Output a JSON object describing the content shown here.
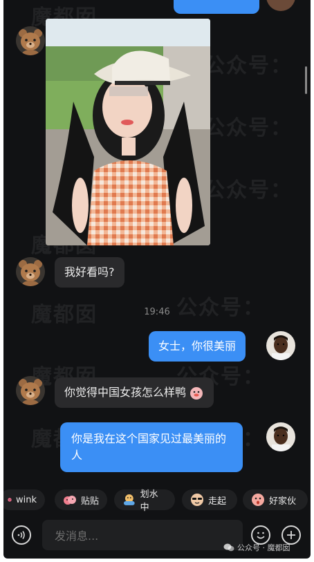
{
  "chat": {
    "bubble_question": "我好看吗?",
    "timestamp": "19:46",
    "bubble_reply1": "女士，你很美丽",
    "bubble_question2": "你觉得中国女孩怎么样鸭",
    "bubble_reply2_line1": "你是我在这个国家见过最美丽的",
    "bubble_reply2_line2": "人"
  },
  "quick_replies": [
    "wink",
    "贴贴",
    "划水中",
    "走起",
    "好家伙"
  ],
  "input": {
    "placeholder": "发消息..."
  },
  "watermark": {
    "text1": "魔都囡",
    "text2": "公众号：",
    "footer": "公众号 · 魔都囡"
  },
  "colors": {
    "outgoing_bubble": "#3b8ff5",
    "incoming_bubble": "#2a2a2c",
    "background": "#111214"
  },
  "icons": [
    "voice-icon",
    "emoji-icon",
    "plus-icon"
  ]
}
